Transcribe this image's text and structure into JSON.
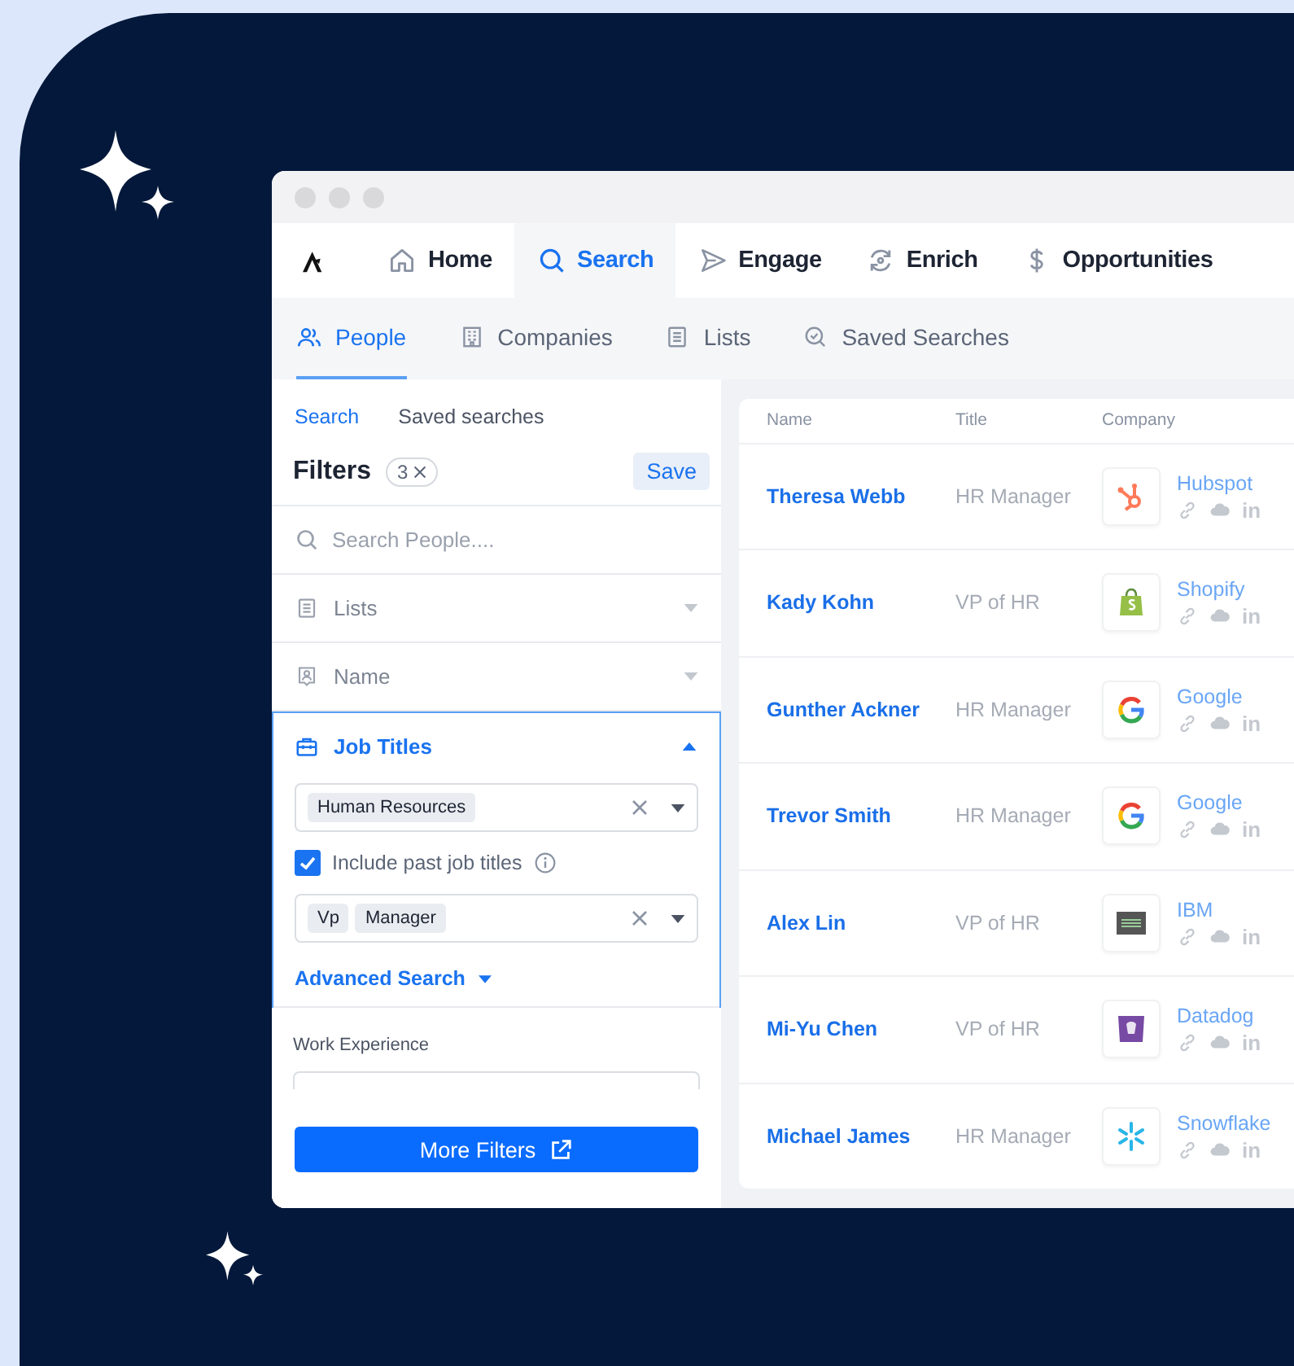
{
  "top_nav": [
    {
      "label": "Home",
      "selected": false
    },
    {
      "label": "Search",
      "selected": true
    },
    {
      "label": "Engage",
      "selected": false
    },
    {
      "label": "Enrich",
      "selected": false
    },
    {
      "label": "Opportunities",
      "selected": false
    }
  ],
  "sub_nav": [
    {
      "label": "People",
      "selected": true
    },
    {
      "label": "Companies",
      "selected": false
    },
    {
      "label": "Lists",
      "selected": false
    },
    {
      "label": "Saved Searches",
      "selected": false
    }
  ],
  "filter_panel": {
    "tabs": [
      {
        "label": "Search",
        "selected": true
      },
      {
        "label": "Saved searches",
        "selected": false
      }
    ],
    "title": "Filters",
    "count": "3",
    "save_button": "Save",
    "search": {
      "placeholder": "Search People...."
    },
    "sections": [
      {
        "label": "Lists",
        "expanded": false
      },
      {
        "label": "Name",
        "expanded": false
      },
      {
        "label": "Job Titles",
        "expanded": true
      }
    ],
    "job_titles": {
      "tags": [
        "Human Resources"
      ],
      "include_past": {
        "label": "Include past job titles",
        "checked": true
      },
      "past_tags": [
        "Vp",
        "Manager"
      ],
      "advanced_search": "Advanced Search"
    },
    "work_experience": {
      "label": "Work Experience"
    },
    "more_filters_button": "More Filters"
  },
  "table": {
    "columns": [
      "Name",
      "Title",
      "Company"
    ],
    "rows": [
      {
        "name": "Theresa Webb",
        "title": "HR Manager",
        "company": "Hubspot",
        "social": "in"
      },
      {
        "name": "Kady Kohn",
        "title": "VP of HR",
        "company": "Shopify",
        "social": "in"
      },
      {
        "name": "Gunther Ackner",
        "title": "HR Manager",
        "company": "Google",
        "social": "in"
      },
      {
        "name": "Trevor Smith",
        "title": "HR Manager",
        "company": "Google",
        "social": "in"
      },
      {
        "name": "Alex Lin",
        "title": "VP of HR",
        "company": "IBM",
        "social": "in"
      },
      {
        "name": "Mi-Yu Chen",
        "title": "VP of HR",
        "company": "Datadog",
        "social": "in"
      },
      {
        "name": "Michael James",
        "title": "HR Manager",
        "company": "Snowflake",
        "social": "in"
      }
    ]
  }
}
